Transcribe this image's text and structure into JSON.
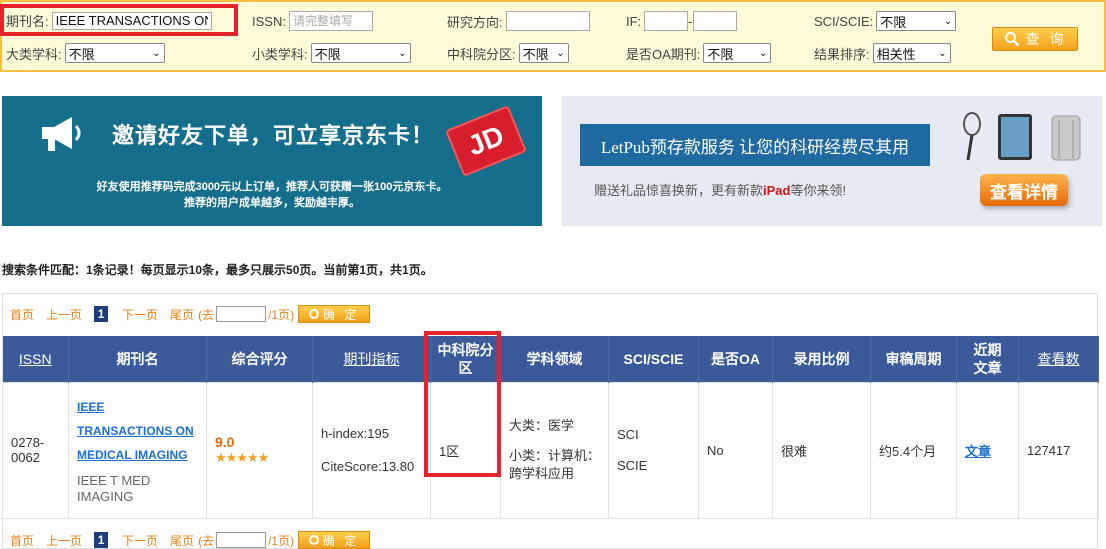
{
  "search": {
    "journal_label": "期刊名:",
    "journal_value": "IEEE TRANSACTIONS ON",
    "issn_label": "ISSN:",
    "issn_placeholder": "请完整填写",
    "direction_label": "研究方向:",
    "if_label": "IF:",
    "sci_label": "SCI/SCIE:",
    "sci_value": "不限",
    "major_label": "大类学科:",
    "major_value": "不限",
    "minor_label": "小类学科:",
    "minor_value": "不限",
    "cas_label": "中科院分区:",
    "cas_value": "不限",
    "oa_label": "是否OA期刊:",
    "oa_value": "不限",
    "sort_label": "结果排序:",
    "sort_value": "相关性",
    "query_label": "查 询"
  },
  "banner1": {
    "title": "邀请好友下单，可立享京东卡！",
    "line1": "好友使用推荐码完成3000元以上订单，推荐人可获赠一张100元京东卡。",
    "line2": "推荐的用户成单越多，奖励越丰厚。",
    "card": "JD"
  },
  "banner2": {
    "title": "LetPub预存款服务  让您的科研经费尽其用",
    "sub_a": "赠送礼品惊喜换新，更有新款",
    "sub_ipad": "iPad",
    "sub_b": "等你来领!",
    "button": "查看详情"
  },
  "summary": "搜索条件匹配：1条记录！每页显示10条，最多只展示50页。当前第1页，共1页。",
  "pager": {
    "first": "首页",
    "prev": "上一页",
    "current": "1",
    "next": "下一页",
    "last": "尾页",
    "goto_a": "(去",
    "goto_b": "/1页)",
    "confirm": "确 定"
  },
  "table": {
    "headers": [
      "ISSN",
      "期刊名",
      "综合评分",
      "期刊指标",
      "中科院分区",
      "学科领域",
      "SCI/SCIE",
      "是否OA",
      "录用比例",
      "审稿周期",
      "近期文章",
      "查看数"
    ],
    "row": {
      "issn": "0278-0062",
      "journal_link": "IEEE TRANSACTIONS ON MEDICAL IMAGING",
      "journal_abbr": "IEEE T MED IMAGING",
      "score": "9.0",
      "stars": "★★★★★",
      "hindex": "h-index:195",
      "citescore": "CiteScore:13.80",
      "cas": "1区",
      "field_major": "大类：医学",
      "field_minor": "小类：计算机：跨学科应用",
      "sci1": "SCI",
      "sci2": "SCIE",
      "oa": "No",
      "accept": "很难",
      "review": "约5.4个月",
      "articles": "文章",
      "views": "127417"
    }
  }
}
